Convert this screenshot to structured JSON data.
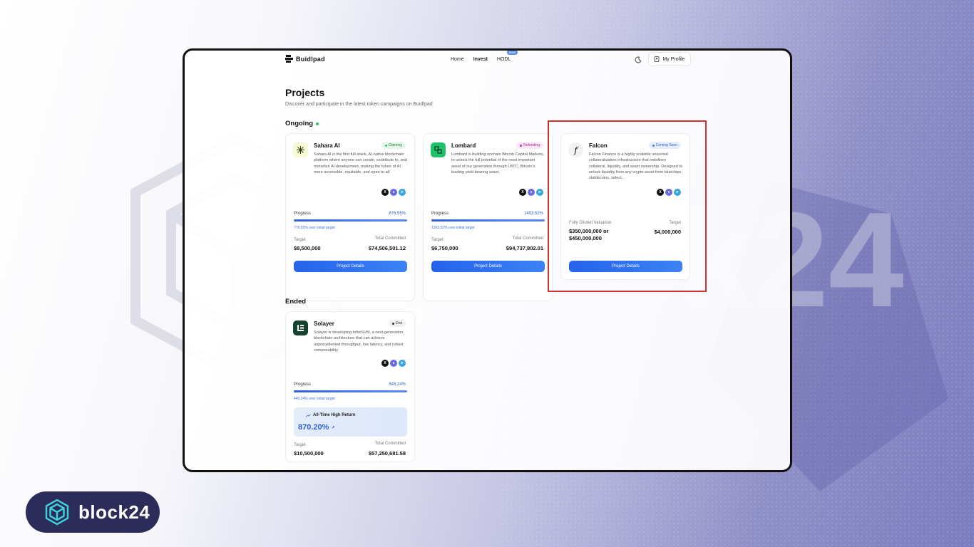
{
  "brand": {
    "name": "block24"
  },
  "watermark": {
    "text": "block24"
  },
  "nav": {
    "logo_text": "Buidlpad",
    "links": [
      "Home",
      "Invest",
      "HODL"
    ],
    "new_badge": "New",
    "profile_label": "My Profile"
  },
  "page": {
    "title": "Projects",
    "subtitle": "Discover and participate in the latest token campaigns on Buidlpad"
  },
  "sections": {
    "ongoing": "Ongoing",
    "ended": "Ended"
  },
  "colors": {
    "accent": "#2563eb",
    "highlight": "#d32f2f",
    "claiming": "#22c55e",
    "refunding": "#c026d3",
    "coming_soon": "#3b82f6"
  },
  "projects": [
    {
      "name": "Sahara AI",
      "status": "Claiming",
      "description": "Sahara AI is the first full-stack, AI-native blockchain platform where anyone can create, contribute to, and monetize AI development, making the future of AI more accessible, equitable, and open to all.",
      "progress_label": "Progress",
      "progress_value": "876.55%",
      "progress_fraction": 1.0,
      "over_target": "776.55% over initial target",
      "target_label": "Target",
      "target": "$8,500,000",
      "committed_label": "Total Committed",
      "committed": "$74,506,501.12",
      "button": "Project Details"
    },
    {
      "name": "Lombard",
      "status": "Refunding",
      "description": "Lombard is building onchain Bitcoin Capital Markets, to unlock the full potential of the most important asset of our generation through LBTC, Bitcoin's leading yield bearing asset.",
      "progress_label": "Progress",
      "progress_value": "1403.52%",
      "progress_fraction": 1.0,
      "over_target": "1303.52% over initial target",
      "target_label": "Target",
      "target": "$6,750,000",
      "committed_label": "Total Committed",
      "committed": "$94,737,802.01",
      "button": "Project Details"
    },
    {
      "name": "Falcon",
      "status": "Coming Soon",
      "description": "Falcon Finance is a highly scalable universal collateralization infrastructure that redefines collateral, liquidity, and asset ownership. Designed to unlock liquidity from any crypto asset from bluechips, stablecoins, select...",
      "fdv_label": "Fully Diluted Valuation",
      "fdv": "$350,000,000 or $450,000,000",
      "target_label": "Target",
      "target": "$4,000,000",
      "button": "Project Details"
    },
    {
      "name": "Solayer",
      "status": "End",
      "description": "Solayer is developing InfiniSVM, a next-generation blockchain architecture that can achieve unprecedented throughput, low latency, and robust composability.",
      "progress_label": "Progress",
      "progress_value": "545.24%",
      "progress_fraction": 1.0,
      "over_target": "445.24% over initial target",
      "ath_label": "All-Time High Return",
      "ath_value": "870.20%",
      "target_label": "Target",
      "target": "$10,500,000",
      "committed_label": "Total Committed",
      "committed": "$57,250,681.58"
    }
  ]
}
